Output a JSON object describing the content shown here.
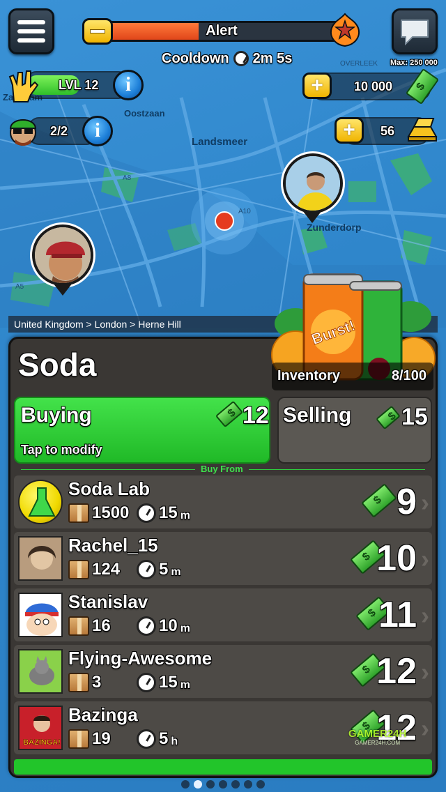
{
  "hud": {
    "alert_label": "Alert",
    "alert_progress": 0.39,
    "cooldown_label": "Cooldown",
    "cooldown_value": "2m 5s",
    "level_label": "LVL 12",
    "crew_label": "2/2",
    "cash_max_label": "Max: 250 000",
    "cash_value": "10 000",
    "gold_value": "56"
  },
  "map": {
    "labels": [
      "Landsmeer",
      "Zunderdorp",
      "Oostzaan",
      "Zaandam",
      "OVERLEEK",
      "A8",
      "A10",
      "A5"
    ]
  },
  "breadcrumb": "United Kingdom > London > Herne Hill",
  "product": {
    "title": "Soda",
    "inventory_label": "Inventory",
    "inventory_value": "8/100",
    "logo_text": "Burst!"
  },
  "buying": {
    "label": "Buying",
    "price": "12",
    "hint": "Tap to modify"
  },
  "selling": {
    "label": "Selling",
    "price": "15"
  },
  "section_title": "Buy From",
  "sellers": [
    {
      "name": "Soda Lab",
      "stock": "1500",
      "time": "15",
      "unit": "m",
      "price": "9"
    },
    {
      "name": "Rachel_15",
      "stock": "124",
      "time": "5",
      "unit": "m",
      "price": "10"
    },
    {
      "name": "Stanislav",
      "stock": "16",
      "time": "10",
      "unit": "m",
      "price": "11"
    },
    {
      "name": "Flying-Awesome",
      "stock": "3",
      "time": "15",
      "unit": "m",
      "price": "12"
    },
    {
      "name": "Bazinga",
      "stock": "19",
      "time": "5",
      "unit": "h",
      "price": "12",
      "avatar_text": "BAZINGA!"
    }
  ],
  "watermark": {
    "brand": "GAMER24H",
    "site": "GAMER24H.COM"
  },
  "pager": {
    "count": 7,
    "active": 1
  },
  "colors": {
    "buying": "#2ecc3e",
    "alert": "#f05a1c",
    "cash": "#3dbb32",
    "panel": "#3a3734"
  }
}
